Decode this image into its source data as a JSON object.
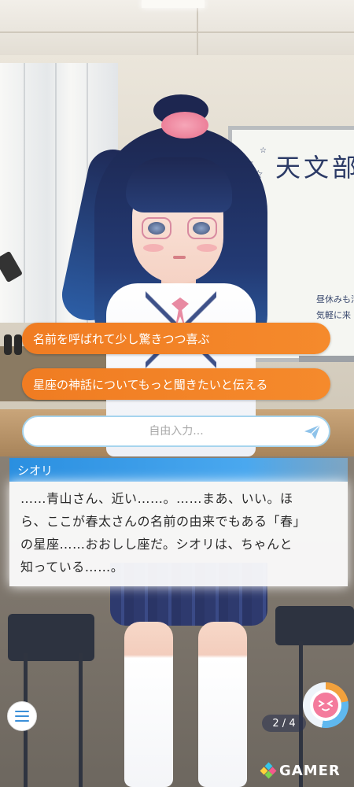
{
  "choices": [
    {
      "label": "名前を呼ばれて少し驚きつつ喜ぶ"
    },
    {
      "label": "星座の神話についてもっと聞きたいと伝える"
    }
  ],
  "free_input": {
    "placeholder": "自由入力..."
  },
  "dialog": {
    "speaker": "シオリ",
    "lines": [
      "……青山さん、近い……。……まあ、いい。ほ",
      "ら、ここが春太さんの名前の由来でもある「春」",
      "の星座……おおしし座だ。シオリは、ちゃんと",
      "知っている……。"
    ]
  },
  "scene": {
    "whiteboard_title": "天文部",
    "whiteboard_notes": [
      "昼休みも活",
      "気軽に来"
    ]
  },
  "page_counter": "2 / 4",
  "watermark": "GAMER",
  "icons": {
    "menu": "hamburger-menu-icon",
    "send": "send-paper-plane-icon",
    "emotion": "emotion-face-icon",
    "watermark": "gamer-logo-icon"
  },
  "colors": {
    "choice": "#f07c22",
    "name_bar": "#2a8fe0",
    "input_border": "#a6d4ee",
    "emotion_face": "#f47b9c"
  }
}
